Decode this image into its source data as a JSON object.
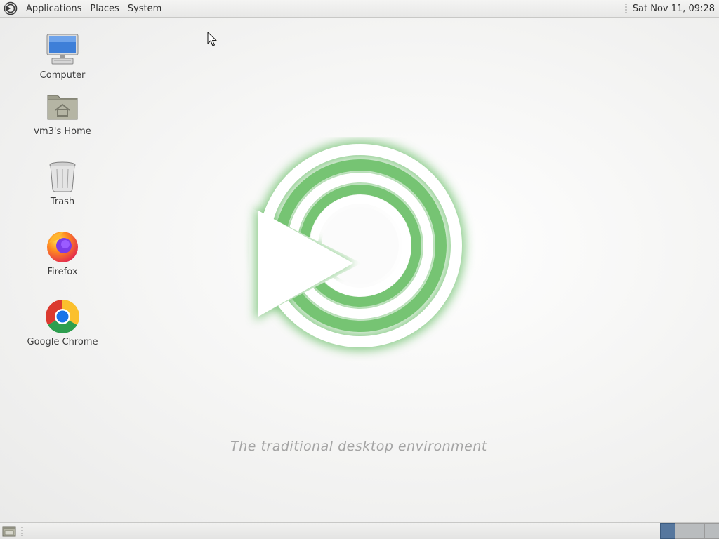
{
  "top_panel": {
    "menus": [
      {
        "label": "Applications"
      },
      {
        "label": "Places"
      },
      {
        "label": "System"
      }
    ],
    "clock": "Sat Nov 11, 09:28"
  },
  "desktop": {
    "icons": [
      {
        "label": "Computer",
        "icon": "computer-icon"
      },
      {
        "label": "vm3's Home",
        "icon": "home-folder-icon"
      },
      {
        "label": "Trash",
        "icon": "trash-icon"
      },
      {
        "label": "Firefox",
        "icon": "firefox-icon"
      },
      {
        "label": "Google Chrome",
        "icon": "chrome-icon"
      }
    ],
    "tagline": "The traditional desktop environment",
    "accent_color": "#6cbf6a"
  },
  "bottom_panel": {
    "workspace_count": 4,
    "active_workspace": 1
  }
}
